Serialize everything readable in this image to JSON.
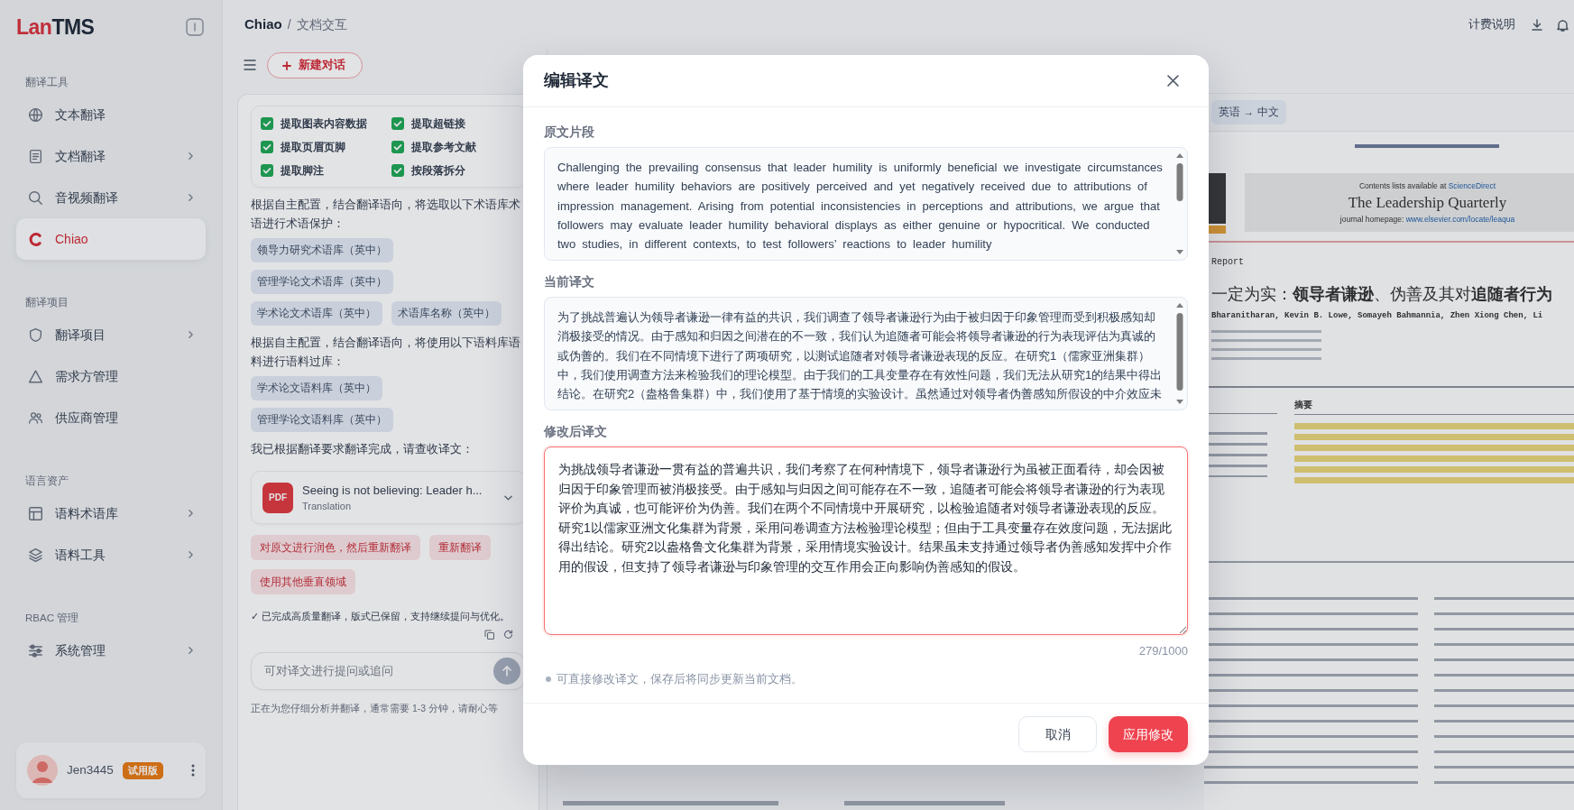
{
  "sidebar": {
    "logo": {
      "accent": "Lan",
      "rest": "TMS"
    },
    "sections": [
      {
        "title": "翻译工具",
        "items": [
          {
            "label": "文本翻译",
            "submenu": false,
            "selected": false
          },
          {
            "label": "文档翻译",
            "submenu": true,
            "selected": false
          },
          {
            "label": "音视频翻译",
            "submenu": true,
            "selected": false
          },
          {
            "label": "Chiao",
            "submenu": false,
            "selected": true
          }
        ]
      },
      {
        "title": "翻译项目",
        "items": [
          {
            "label": "翻译项目",
            "submenu": true,
            "selected": false
          },
          {
            "label": "需求方管理",
            "submenu": false,
            "selected": false
          },
          {
            "label": "供应商管理",
            "submenu": false,
            "selected": false
          }
        ]
      },
      {
        "title": "语言资产",
        "items": [
          {
            "label": "语料术语库",
            "submenu": true,
            "selected": false
          },
          {
            "label": "语料工具",
            "submenu": true,
            "selected": false
          }
        ]
      },
      {
        "title": "RBAC 管理",
        "items": [
          {
            "label": "系统管理",
            "submenu": true,
            "selected": false
          }
        ]
      }
    ],
    "user": {
      "name": "Jen3445",
      "badge": "试用版"
    }
  },
  "header": {
    "breadcrumb": {
      "root": "Chiao",
      "separator": "/",
      "page": "文档交互"
    },
    "billing_link": "计费说明"
  },
  "chat": {
    "new_chat": "新建对话",
    "options": [
      {
        "label": "提取图表内容数据",
        "checked": true
      },
      {
        "label": "提取超链接",
        "checked": true
      },
      {
        "label": "提取页眉页脚",
        "checked": true
      },
      {
        "label": "提取参考文献",
        "checked": true
      },
      {
        "label": "提取脚注",
        "checked": true
      },
      {
        "label": "按段落拆分",
        "checked": true
      }
    ],
    "messages": [
      {
        "kind": "paragraph",
        "text": "根据自主配置，结合翻译语向，将选取以下术语库术语进行术语保护："
      },
      {
        "kind": "tags",
        "tags": [
          "领导力研究术语库（英中）",
          "管理学论文术语库（英中）",
          "学术论文术语库（英中）",
          "术语库名称（英中）"
        ]
      },
      {
        "kind": "paragraph",
        "text": "根据自主配置，结合翻译语向，将使用以下语料库语料进行语料过库："
      },
      {
        "kind": "tags",
        "tags": [
          "学术论文语料库（英中）",
          "管理学论文语料库（英中）"
        ]
      },
      {
        "kind": "paragraph",
        "text": "我已根据翻译要求翻译完成，请查收译文："
      },
      {
        "kind": "file",
        "badge": "PDF",
        "name": "Seeing is not believing: Leader h...",
        "subtitle": "Translation"
      },
      {
        "kind": "actions",
        "actions": [
          "对原文进行润色，然后重新翻译",
          "重新翻译",
          "使用其他垂直领域"
        ]
      },
      {
        "kind": "status",
        "text": "✓ 已完成高质量翻译，版式已保留，支持继续提问与优化。"
      }
    ],
    "input_placeholder": "可对译文进行提问或追问",
    "footnote": "正在为您仔细分析并翻译，通常需要 1-3 分钟，请耐心等"
  },
  "document": {
    "language_pair": "英语 → 中文",
    "availability": "Contents lists available at ",
    "availability_link": "ScienceDirect",
    "journal": "The Leadership Quarterly",
    "homepage": "journal homepage: ",
    "homepage_link": "www.elsevier.com/locate/leaqua",
    "article_type": "Report",
    "title": "一定为实：**领导者谦逊**、伪善及其对**追随者行为**",
    "authors": "Bharanitharan, Kevin B. Lowe, Somayeh Bahmannia, Zhen Xiong Chen, Li",
    "abstract_heading": "摘要"
  },
  "dialog": {
    "title": "编辑译文",
    "fields": [
      {
        "kind": "readonly",
        "label": "原文片段",
        "text": "Challenging the prevailing consensus that leader humility is uniformly beneficial we investigate circumstances where leader humility behaviors are positively perceived and yet negatively received due to attributions of impression management. Arising from potential inconsistencies in perceptions and attributions, we argue that followers may evaluate leader humility behavioral displays as either genuine or hypocritical. We conducted two studies, in different contexts, to test followers’ reactions to leader humility"
      },
      {
        "kind": "readonly",
        "label": "当前译文",
        "text": "为了挑战普遍认为领导者谦逊一律有益的共识，我们调查了领导者谦逊行为由于被归因于印象管理而受到积极感知却消极接受的情况。由于感知和归因之间潜在的不一致，我们认为追随者可能会将领导者谦逊的行为表现评估为真诚的或伪善的。我们在不同情境下进行了两项研究，以测试追随者对领导者谦逊表现的反应。在研究1（儒家亚洲集群）中，我们使用调查方法来检验我们的理论模型。由于我们的工具变量存在有效性问题，我们无法从研究1的结果中得出结论。在研究2（盎格鲁集群）中，我们使用了基于情境的实验设计。虽然通过对领导者伪善感知所假设的中介效应未"
      },
      {
        "kind": "editable",
        "label": "修改后译文",
        "focused": true,
        "value": "为挑战领导者谦逊一贯有益的普遍共识，我们考察了在何种情境下，领导者谦逊行为虽被正面看待，却会因被归因于印象管理而被消极接受。由于感知与归因之间可能存在不一致，追随者可能会将领导者谦逊的行为表现评价为真诚，也可能评价为伪善。我们在两个不同情境中开展研究，以检验追随者对领导者谦逊表现的反应。研究1以儒家亚洲文化集群为背景，采用问卷调查方法检验理论模型；但由于工具变量存在效度问题，无法据此得出结论。研究2以盎格鲁文化集群为背景，采用情境实验设计。结果虽未支持通过领导者伪善感知发挥中介作用的假设，但支持了领导者谦逊与印象管理的交互作用会正向影响伪善感知的假设。"
      }
    ],
    "counter": "279/1000",
    "hint": "可直接修改译文，保存后将同步更新当前文档。",
    "buttons": [
      {
        "kind": "secondary",
        "label": "取消"
      },
      {
        "kind": "primary",
        "label": "应用修改"
      }
    ]
  }
}
